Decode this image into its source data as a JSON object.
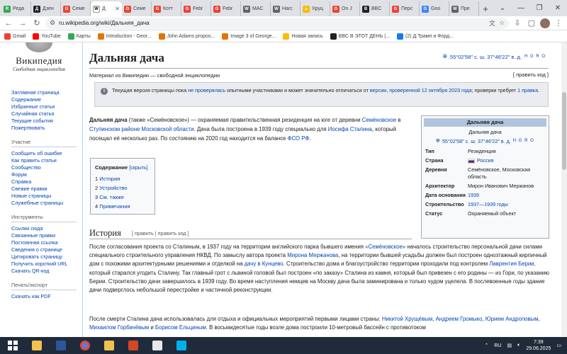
{
  "browser": {
    "tabs": [
      {
        "label": "Реда",
        "color": "#34a853",
        "glyph": "R"
      },
      {
        "label": "Дзен",
        "color": "#202124",
        "glyph": "Д"
      },
      {
        "label": "Семе",
        "color": "#ea4335",
        "glyph": "G"
      },
      {
        "label": "Д",
        "color": "#ffffff",
        "glyph": "W",
        "active": true
      },
      {
        "label": "Семе",
        "color": "#ea4335",
        "glyph": "G"
      },
      {
        "label": "Котт",
        "color": "#ea4335",
        "glyph": "G"
      },
      {
        "label": "Febr",
        "color": "#ea4335",
        "glyph": "G"
      },
      {
        "label": "Febr",
        "color": "#ea4335",
        "glyph": "G"
      },
      {
        "label": "MAC",
        "color": "#5f6368",
        "glyph": "W"
      },
      {
        "label": "Harc",
        "color": "#5f6368",
        "glyph": "W"
      },
      {
        "label": "Хруц",
        "color": "#fbbc04",
        "glyph": "▲"
      },
      {
        "label": "On J",
        "color": "#ea4335",
        "glyph": "G"
      },
      {
        "label": "BBC",
        "color": "#202124",
        "glyph": "B"
      },
      {
        "label": "Перс",
        "color": "#ea4335",
        "glyph": "G"
      },
      {
        "label": "Goo",
        "color": "#4285f4",
        "glyph": "G"
      },
      {
        "label": "Пре",
        "color": "#5f6368",
        "glyph": "W"
      }
    ],
    "url": "ru.wikipedia.org/wiki/Дальняя_дача",
    "bookmarks": [
      {
        "label": "Gmail",
        "color": "#ea4335"
      },
      {
        "label": "YouTube",
        "color": "#ff0000"
      },
      {
        "label": "Карты",
        "color": "#34a853"
      },
      {
        "label": "Introduction - Geor...",
        "color": "#e37400"
      },
      {
        "label": "John Adams propos...",
        "color": "#e37400"
      },
      {
        "label": "Image 3 of George...",
        "color": "#e37400"
      },
      {
        "label": "Новая запись",
        "color": "#fbbc04"
      },
      {
        "label": "BBC В ЭТОТ ДЕНЬ |...",
        "color": "#202124"
      },
      {
        "label": "(2) Д.Трамп и Форд...",
        "color": "#1877f2"
      }
    ]
  },
  "wiki": {
    "logo_name": "Википедия",
    "logo_tagline": "Свободная энциклопедия",
    "sidebar": {
      "main": [
        "Заглавная страница",
        "Содержание",
        "Избранные статьи",
        "Случайная статья",
        "Текущие события",
        "Пожертвовать"
      ],
      "participation_head": "Участие",
      "participation": [
        "Сообщить об ошибке",
        "Как править статьи",
        "Сообщество",
        "Форум",
        "Справка",
        "Свежие правки",
        "Новые страницы",
        "Служебные страницы"
      ],
      "tools_head": "Инструменты",
      "tools": [
        "Ссылки сюда",
        "Связанные правки",
        "Постоянная ссылка",
        "Сведения о странице",
        "Цитировать страницу",
        "Получить короткий URL",
        "Скачать QR-код"
      ],
      "print_head": "Печать/экспорт",
      "print": [
        "Скачать как PDF"
      ]
    },
    "title": "Дальняя дача",
    "coords": "55°02′58″ с. ш. 37°46′22″ в. д.",
    "coords_hgro": "H G R O",
    "from_wiki": "Материал из Википедии — свободной энциклопедии",
    "edit_code": "[ править код ]",
    "notice": {
      "prefix": "Текущая версия страницы пока ",
      "link1": "не проверялась",
      "mid": " опытными участниками и может значительно отличаться от ",
      "link2": "версии, проверенной 12 октября 2023 года",
      "suffix": "; проверки требует ",
      "link3": "1 правка",
      "end": "."
    },
    "lead": {
      "bold": "Дальняя дача",
      "t1": " (также «Семёновское») — охраняемая правительственная резиденция на юге от деревни ",
      "l1": "Семёновское",
      "t2": " в ",
      "l2": "Ступинском районе",
      "t3": " ",
      "l3": "Московской области",
      "t4": ". Дача была построена в 1939 году специально для ",
      "l4": "Иосифа Сталина",
      "t5": ", который посещал её несколько раз. По состоянию на 2020 год находится на балансе ",
      "l5": "ФСО РФ",
      "t6": "."
    },
    "toc": {
      "head": "Содержание",
      "hide": "[скрыть]",
      "items": [
        {
          "num": "1",
          "label": "История"
        },
        {
          "num": "2",
          "label": "Устройство"
        },
        {
          "num": "3",
          "label": "См. также"
        },
        {
          "num": "4",
          "label": "Примечания"
        }
      ]
    },
    "infobox": {
      "head": "Дальняя дача",
      "sub": "Дальняя дача",
      "coords": "55°02′58″ с. ш. 37°46′22″ в. д.",
      "coords_hgro": "H G R O",
      "rows": [
        {
          "label": "Тип",
          "value": "Резиденция",
          "link": false
        },
        {
          "label": "Страна",
          "value": "Россия",
          "link": true,
          "flag": true
        },
        {
          "label": "Деревня",
          "value": "Семёновское, Московская область",
          "link": false
        },
        {
          "label": "Архитектор",
          "value": "Мирон Иванович Мержанов",
          "link": false
        },
        {
          "label": "Дата основания",
          "value": "1939",
          "link": true
        },
        {
          "label": "Строительство",
          "value": "1937—1939 годы",
          "link": true
        },
        {
          "label": "Статус",
          "value": "Охраняемый объект",
          "link": false
        }
      ]
    },
    "history": {
      "heading": "История",
      "edit": "[ править | править код ]"
    },
    "para1": [
      {
        "t": "После согласования проекта со Сталиным, в 1937 году на территории английского парка бывшего имения "
      },
      {
        "l": "«Семёновское»"
      },
      {
        "t": " началось строительство персональной дачи силами специального строительного управления НКВД. По замыслу автора проекта "
      },
      {
        "l": "Мирона Мержанова"
      },
      {
        "t": ", на территории бывшей усадьбы должен был построен однозтажный кирпичный дом с похожими архитектурными решениями и отделкой на "
      },
      {
        "l": "дачу в Кунцево"
      },
      {
        "t": ". Строительство дома и благоустройство территории проходили под контролем "
      },
      {
        "l": "Лаврентия Берии"
      },
      {
        "t": ", который старался угодить Сталину. Так главный грот с львиной головой был построен «по заказу» Сталина из камня, который был привезен с его родины — из Гори, по указанию Берии. Строительство дачи завершилось в 1939 году. Во время наступления немцев на Москву дача была заминирована и только чудом уцелела. В послевоенные годы здание дачи подверглось небольшой перестройке и частичной реконструкции."
      }
    ],
    "para2": [
      {
        "t": "После смерти Сталина дача использовалась для отдыха и официальных мероприятий первыми лицами страны: "
      },
      {
        "l": "Никитой Хрущёвым"
      },
      {
        "t": ", "
      },
      {
        "l": "Андреем Громыко"
      },
      {
        "t": ", "
      },
      {
        "l": "Юрием Андроповым"
      },
      {
        "t": ", "
      },
      {
        "l": "Михаилом Горбачёвым"
      },
      {
        "t": " и "
      },
      {
        "l": "Борисом Ельциным"
      },
      {
        "t": ". В восьмидесятые годы возле дома построили 10-метровый бассейн с противотоком"
      }
    ]
  },
  "taskbar": {
    "apps": [
      {
        "name": "explorer",
        "color": "#f2c14e"
      },
      {
        "name": "word",
        "color": "#2b579a"
      },
      {
        "name": "chrome",
        "color": "#4285f4"
      },
      {
        "name": "files",
        "color": "#f2c14e"
      },
      {
        "name": "presentation",
        "color": "#d24726"
      },
      {
        "name": "media",
        "color": "#e6e6e6"
      },
      {
        "name": "skype",
        "color": "#00aff0"
      }
    ],
    "lang": "RU",
    "time": "7:39",
    "date": "29.06.2025"
  }
}
